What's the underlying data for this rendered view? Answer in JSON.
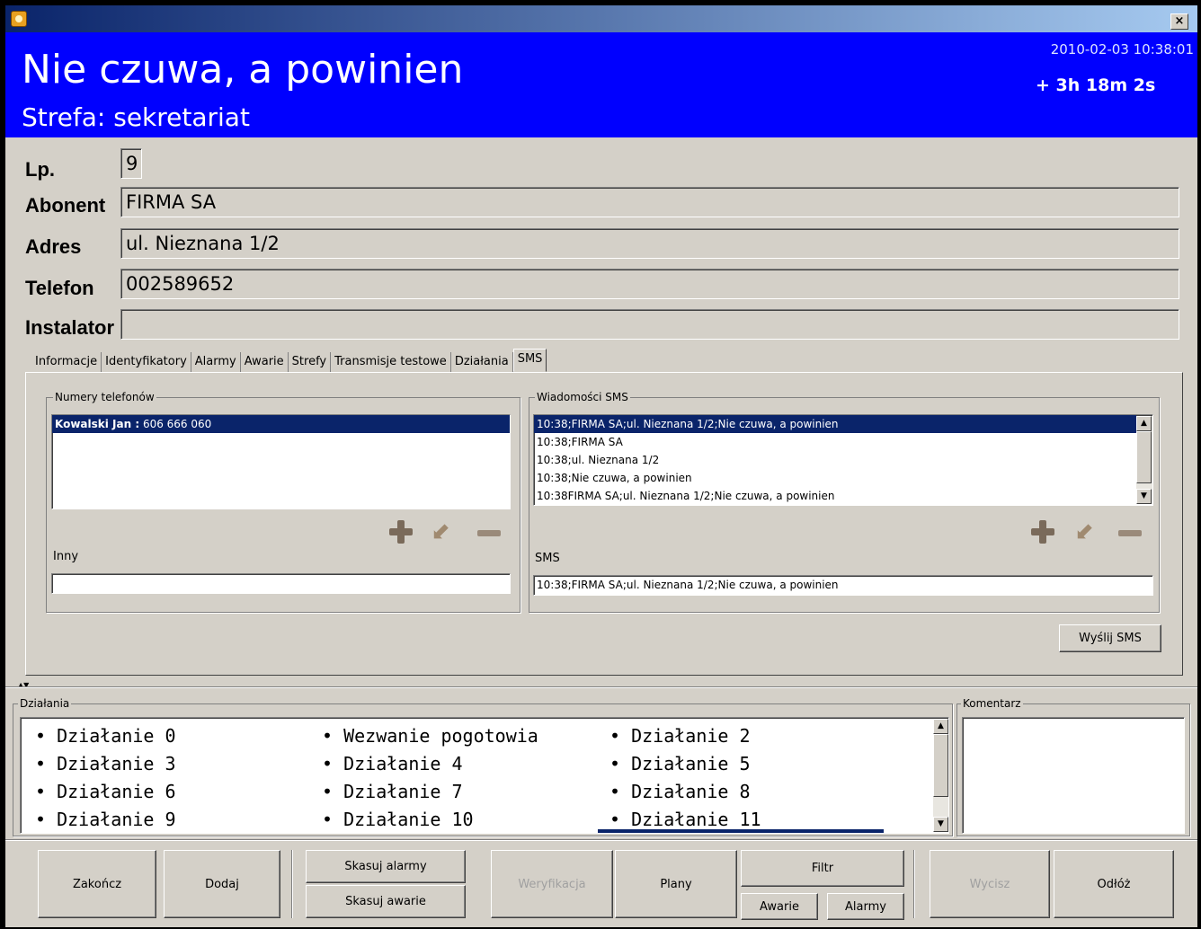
{
  "window": {
    "close_label": "×"
  },
  "banner": {
    "title": "Nie czuwa, a powinien",
    "zone": "Strefa: sekretariat",
    "datetime": "2010-02-03 10:38:01",
    "elapsed": "+ 3h 18m 2s"
  },
  "fields": {
    "lp": {
      "label": "Lp.",
      "value": "9"
    },
    "abonent": {
      "label": "Abonent",
      "value": "FIRMA SA"
    },
    "adres": {
      "label": "Adres",
      "value": "ul. Nieznana 1/2"
    },
    "telefon": {
      "label": "Telefon",
      "value": "002589652"
    },
    "instalator": {
      "label": "Instalator",
      "value": ""
    }
  },
  "tabs": [
    "Informacje",
    "Identyfikatory",
    "Alarmy",
    "Awarie",
    "Strefy",
    "Transmisje testowe",
    "Działania",
    "SMS"
  ],
  "sms": {
    "phones_title": "Numery telefonów",
    "phones": [
      {
        "name": "Kowalski Jan :",
        "number": " 606 666 060"
      }
    ],
    "inny_label": "Inny",
    "inny_value": "",
    "messages_title": "Wiadomości SMS",
    "messages": [
      "10:38;FIRMA SA;ul. Nieznana 1/2;Nie czuwa, a powinien",
      "10:38;FIRMA SA",
      "10:38;ul. Nieznana 1/2",
      "10:38;Nie czuwa, a powinien",
      "10:38FIRMA SA;ul. Nieznana 1/2;Nie czuwa, a powinien"
    ],
    "sms_label": "SMS",
    "sms_value": "10:38;FIRMA SA;ul. Nieznana 1/2;Nie czuwa, a powinien",
    "send_label": "Wyślij SMS"
  },
  "actions": {
    "title": "Działania",
    "items": [
      "• Działanie 0",
      "• Wezwanie pogotowia",
      "• Działanie 2",
      "• Działanie 3",
      "• Działanie 4",
      "• Działanie 5",
      "• Działanie 6",
      "• Działanie 7",
      "• Działanie 8",
      "• Działanie 9",
      "• Działanie 10",
      "• Działanie 11"
    ],
    "comment_title": "Komentarz"
  },
  "buttons": {
    "zakoncz": "Zakończ",
    "dodaj": "Dodaj",
    "skasuj_alarmy": "Skasuj alarmy",
    "skasuj_awarie": "Skasuj awarie",
    "weryfikacja": "Weryfikacja",
    "plany": "Plany",
    "filtr": "Filtr",
    "awarie": "Awarie",
    "alarmy": "Alarmy",
    "wycisz": "Wycisz",
    "odloz": "Odłóż"
  }
}
